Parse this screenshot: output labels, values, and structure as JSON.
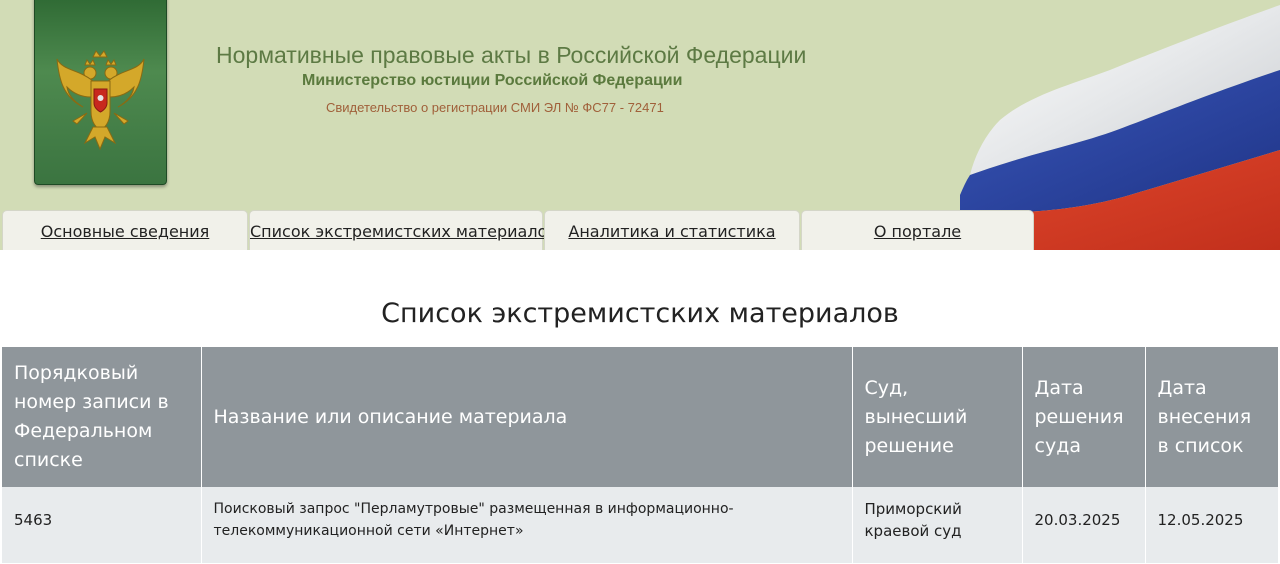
{
  "header": {
    "site_title": "Нормативные правовые акты в Российской Федерации",
    "ministry": "Министерство юстиции Российской Федерации",
    "certificate": "Свидетельство о регистрации СМИ ЭЛ № ФС77 - 72471"
  },
  "nav": {
    "tabs": [
      {
        "label": "Основные сведения"
      },
      {
        "label": "Список экстремистских материалов"
      },
      {
        "label": "Аналитика и статистика"
      },
      {
        "label": "О портале"
      }
    ]
  },
  "main": {
    "title": "Список экстремистских материалов",
    "table": {
      "columns": [
        "Порядковый номер записи в Федеральном списке",
        "Название или описание материала",
        "Суд, вынесший решение",
        "Дата решения суда",
        "Дата внесения в список"
      ],
      "rows": [
        {
          "number": "5463",
          "description": "Поисковый запрос \"Перламутровые\" размещенная в информационно-телекоммуникационной сети «Интернет»",
          "court": "Приморский краевой суд",
          "decision_date": "20.03.2025",
          "added_date": "12.05.2025"
        }
      ]
    }
  },
  "colors": {
    "header_bg": "#d2dcb6",
    "emblem_bg": "#3b7440",
    "table_header_bg": "#8f969b",
    "table_row_bg": "#e8ebed"
  },
  "icons": {
    "emblem": "double-headed-eagle-coat-of-arms",
    "flag": "russian-flag-waving"
  }
}
